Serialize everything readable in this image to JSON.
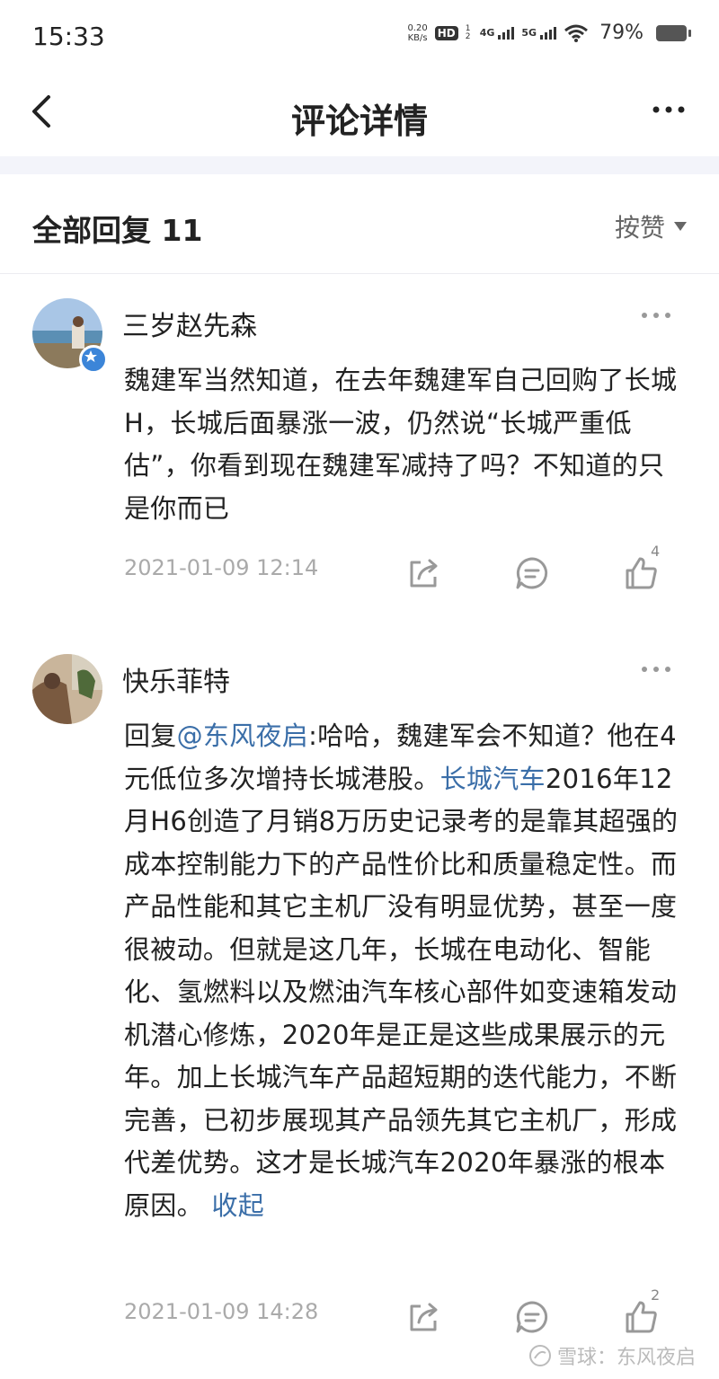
{
  "status_bar": {
    "time": "15:33",
    "net_speed_value": "0.20",
    "net_speed_unit": "KB/s",
    "hd_label": "HD",
    "hd_sub": "1 2",
    "net1": "4G",
    "net2": "5G",
    "battery": "79%"
  },
  "header": {
    "title": "评论详情",
    "back_icon": "chevron-left-icon",
    "more_icon": "more-horizontal-icon"
  },
  "replies_header": {
    "label": "全部回复 11",
    "sort_label": "按赞"
  },
  "comments": [
    {
      "username": "三岁赵先森",
      "content": "魏建军当然知道，在去年魏建军自己回购了长城H，长城后面暴涨一波，仍然说“长城严重低估”，你看到现在魏建军减持了吗？不知道的只是你而已",
      "time": "2021-01-09 12:14",
      "like_count": "4"
    },
    {
      "username": "快乐菲特",
      "reply_prefix": "回复",
      "mention": "@东风夜启",
      "content_part1": ":哈哈，魏建军会不知道？他在4元低位多次增持长城港股。",
      "stock_link": "长城汽车",
      "content_part2": "2016年12月H6创造了月销8万历史记录考的是靠其超强的成本控制能力下的产品性价比和质量稳定性。而产品性能和其它主机厂没有明显优势，甚至一度很被动。但就是这几年，长城在电动化、智能化、氢燃料以及燃油汽车核心部件如变速箱发动机潜心修炼，2020年是正是这些成果展示的元年。加上长城汽车产品超短期的迭代能力，不断完善，已初步展现其产品领先其它主机厂，形成代差优势。这才是长城汽车2020年暴涨的根本原因。",
      "collapse_label": "收起",
      "time": "2021-01-09 14:28",
      "like_count": "2"
    }
  ],
  "watermark": "雪球：东风夜启",
  "colors": {
    "link": "#3a6ea8",
    "badge": "#3c85d8",
    "meta": "#aaaaaa",
    "band": "#f3f4fa"
  }
}
